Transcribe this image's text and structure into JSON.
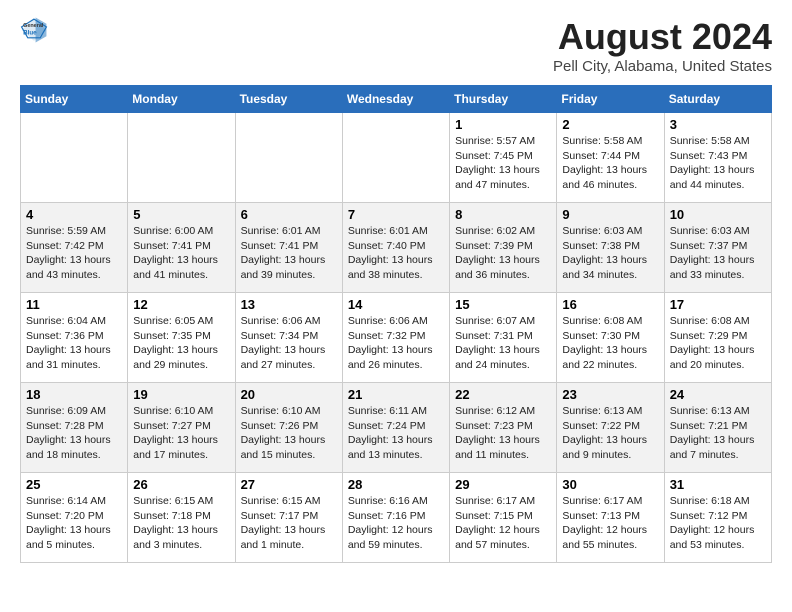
{
  "header": {
    "logo": {
      "general": "General",
      "blue": "Blue"
    },
    "title": "August 2024",
    "subtitle": "Pell City, Alabama, United States"
  },
  "columns": [
    "Sunday",
    "Monday",
    "Tuesday",
    "Wednesday",
    "Thursday",
    "Friday",
    "Saturday"
  ],
  "weeks": [
    {
      "cells": [
        {
          "day": "",
          "info": ""
        },
        {
          "day": "",
          "info": ""
        },
        {
          "day": "",
          "info": ""
        },
        {
          "day": "",
          "info": ""
        },
        {
          "day": "1",
          "info": "Sunrise: 5:57 AM\nSunset: 7:45 PM\nDaylight: 13 hours\nand 47 minutes."
        },
        {
          "day": "2",
          "info": "Sunrise: 5:58 AM\nSunset: 7:44 PM\nDaylight: 13 hours\nand 46 minutes."
        },
        {
          "day": "3",
          "info": "Sunrise: 5:58 AM\nSunset: 7:43 PM\nDaylight: 13 hours\nand 44 minutes."
        }
      ]
    },
    {
      "cells": [
        {
          "day": "4",
          "info": "Sunrise: 5:59 AM\nSunset: 7:42 PM\nDaylight: 13 hours\nand 43 minutes."
        },
        {
          "day": "5",
          "info": "Sunrise: 6:00 AM\nSunset: 7:41 PM\nDaylight: 13 hours\nand 41 minutes."
        },
        {
          "day": "6",
          "info": "Sunrise: 6:01 AM\nSunset: 7:41 PM\nDaylight: 13 hours\nand 39 minutes."
        },
        {
          "day": "7",
          "info": "Sunrise: 6:01 AM\nSunset: 7:40 PM\nDaylight: 13 hours\nand 38 minutes."
        },
        {
          "day": "8",
          "info": "Sunrise: 6:02 AM\nSunset: 7:39 PM\nDaylight: 13 hours\nand 36 minutes."
        },
        {
          "day": "9",
          "info": "Sunrise: 6:03 AM\nSunset: 7:38 PM\nDaylight: 13 hours\nand 34 minutes."
        },
        {
          "day": "10",
          "info": "Sunrise: 6:03 AM\nSunset: 7:37 PM\nDaylight: 13 hours\nand 33 minutes."
        }
      ]
    },
    {
      "cells": [
        {
          "day": "11",
          "info": "Sunrise: 6:04 AM\nSunset: 7:36 PM\nDaylight: 13 hours\nand 31 minutes."
        },
        {
          "day": "12",
          "info": "Sunrise: 6:05 AM\nSunset: 7:35 PM\nDaylight: 13 hours\nand 29 minutes."
        },
        {
          "day": "13",
          "info": "Sunrise: 6:06 AM\nSunset: 7:34 PM\nDaylight: 13 hours\nand 27 minutes."
        },
        {
          "day": "14",
          "info": "Sunrise: 6:06 AM\nSunset: 7:32 PM\nDaylight: 13 hours\nand 26 minutes."
        },
        {
          "day": "15",
          "info": "Sunrise: 6:07 AM\nSunset: 7:31 PM\nDaylight: 13 hours\nand 24 minutes."
        },
        {
          "day": "16",
          "info": "Sunrise: 6:08 AM\nSunset: 7:30 PM\nDaylight: 13 hours\nand 22 minutes."
        },
        {
          "day": "17",
          "info": "Sunrise: 6:08 AM\nSunset: 7:29 PM\nDaylight: 13 hours\nand 20 minutes."
        }
      ]
    },
    {
      "cells": [
        {
          "day": "18",
          "info": "Sunrise: 6:09 AM\nSunset: 7:28 PM\nDaylight: 13 hours\nand 18 minutes."
        },
        {
          "day": "19",
          "info": "Sunrise: 6:10 AM\nSunset: 7:27 PM\nDaylight: 13 hours\nand 17 minutes."
        },
        {
          "day": "20",
          "info": "Sunrise: 6:10 AM\nSunset: 7:26 PM\nDaylight: 13 hours\nand 15 minutes."
        },
        {
          "day": "21",
          "info": "Sunrise: 6:11 AM\nSunset: 7:24 PM\nDaylight: 13 hours\nand 13 minutes."
        },
        {
          "day": "22",
          "info": "Sunrise: 6:12 AM\nSunset: 7:23 PM\nDaylight: 13 hours\nand 11 minutes."
        },
        {
          "day": "23",
          "info": "Sunrise: 6:13 AM\nSunset: 7:22 PM\nDaylight: 13 hours\nand 9 minutes."
        },
        {
          "day": "24",
          "info": "Sunrise: 6:13 AM\nSunset: 7:21 PM\nDaylight: 13 hours\nand 7 minutes."
        }
      ]
    },
    {
      "cells": [
        {
          "day": "25",
          "info": "Sunrise: 6:14 AM\nSunset: 7:20 PM\nDaylight: 13 hours\nand 5 minutes."
        },
        {
          "day": "26",
          "info": "Sunrise: 6:15 AM\nSunset: 7:18 PM\nDaylight: 13 hours\nand 3 minutes."
        },
        {
          "day": "27",
          "info": "Sunrise: 6:15 AM\nSunset: 7:17 PM\nDaylight: 13 hours\nand 1 minute."
        },
        {
          "day": "28",
          "info": "Sunrise: 6:16 AM\nSunset: 7:16 PM\nDaylight: 12 hours\nand 59 minutes."
        },
        {
          "day": "29",
          "info": "Sunrise: 6:17 AM\nSunset: 7:15 PM\nDaylight: 12 hours\nand 57 minutes."
        },
        {
          "day": "30",
          "info": "Sunrise: 6:17 AM\nSunset: 7:13 PM\nDaylight: 12 hours\nand 55 minutes."
        },
        {
          "day": "31",
          "info": "Sunrise: 6:18 AM\nSunset: 7:12 PM\nDaylight: 12 hours\nand 53 minutes."
        }
      ]
    }
  ]
}
